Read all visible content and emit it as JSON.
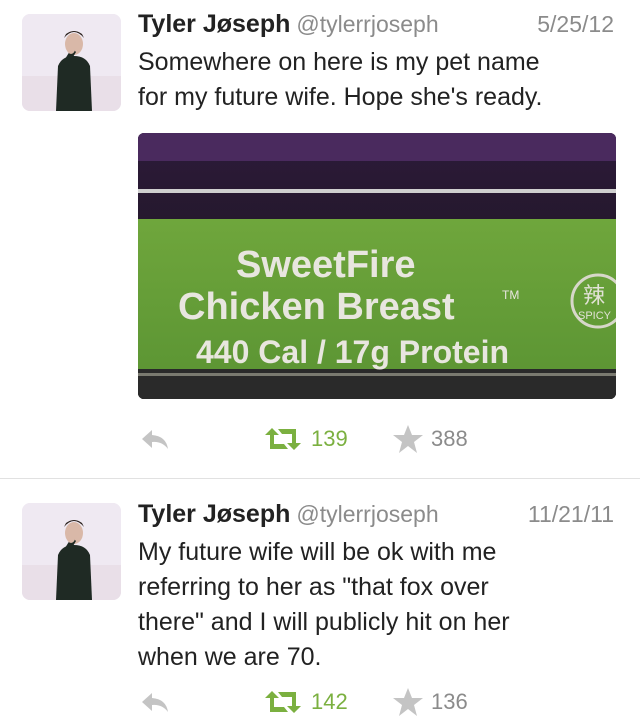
{
  "colors": {
    "retweet_green": "#7bb040",
    "meta_gray": "#8b8b8b",
    "divider": "#e1e1e1",
    "package_green": "#71a83c"
  },
  "tweets": [
    {
      "author_name": "Tyler Jøseph",
      "handle": "@tylerrjoseph",
      "date": "5/25/12",
      "lines": [
        "Somewhere on here is my pet name",
        "for my future wife. Hope she's ready."
      ],
      "media": {
        "line1": "SweetFire",
        "line2": "Chicken Breast",
        "tm": "TM",
        "line3": "440 Cal / 17g Protein",
        "badge_char": "辣",
        "badge_label": "SPICY"
      },
      "retweets": "139",
      "favorites": "388",
      "icons": [
        "reply-icon",
        "retweet-icon",
        "star-icon"
      ]
    },
    {
      "author_name": "Tyler Jøseph",
      "handle": "@tylerrjoseph",
      "date": "11/21/11",
      "lines": [
        "My future wife will be ok with me",
        "referring to her as \"that fox over",
        "there\" and I will publicly hit on her",
        "when we are 70."
      ],
      "retweets": "142",
      "favorites": "136",
      "icons": [
        "reply-icon",
        "retweet-icon",
        "star-icon"
      ]
    }
  ]
}
